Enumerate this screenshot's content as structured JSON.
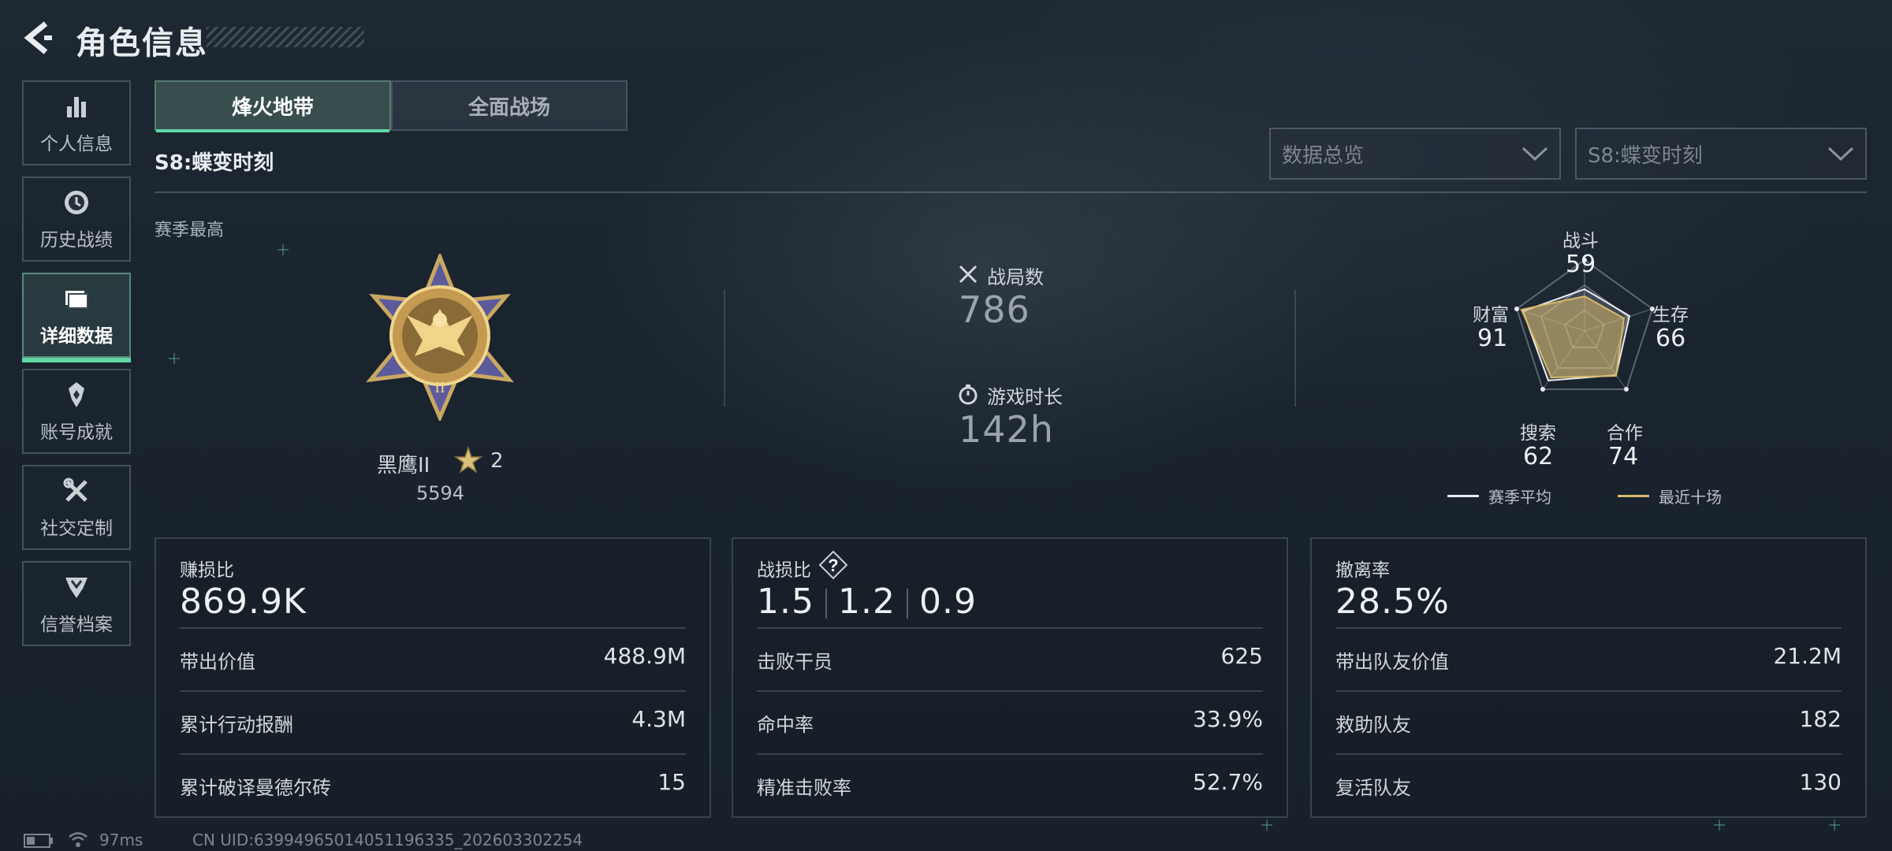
{
  "header": {
    "title": "角色信息"
  },
  "sidebar": {
    "items": [
      {
        "label": "个人信息",
        "icon": "bar-chart-icon"
      },
      {
        "label": "历史战绩",
        "icon": "history-icon"
      },
      {
        "label": "详细数据",
        "icon": "folder-icon",
        "active": true
      },
      {
        "label": "账号成就",
        "icon": "achievement-icon"
      },
      {
        "label": "社交定制",
        "icon": "tools-icon"
      },
      {
        "label": "信誉档案",
        "icon": "credit-icon"
      }
    ]
  },
  "tabs": [
    {
      "label": "烽火地带",
      "active": true
    },
    {
      "label": "全面战场",
      "active": false
    }
  ],
  "season": "S8:蝶变时刻",
  "filters": {
    "category": "数据总览",
    "season": "S8:蝶变时刻"
  },
  "season_best": {
    "label": "赛季最高",
    "rank_name": "黑鹰II",
    "stars": "2",
    "score": "5594"
  },
  "stats": {
    "matches_label": "战局数",
    "matches_value": "786",
    "playtime_label": "游戏时长",
    "playtime_value": "142h"
  },
  "radar": {
    "combat_label": "战斗",
    "combat_value": "59",
    "survival_label": "生存",
    "survival_value": "66",
    "teamwork_label": "合作",
    "teamwork_value": "74",
    "search_label": "搜索",
    "search_value": "62",
    "wealth_label": "财富",
    "wealth_value": "91",
    "legend_season": "赛季平均",
    "legend_recent": "最近十场",
    "colors": {
      "season": "#e8ecef",
      "recent": "#d8b86a"
    }
  },
  "panels": {
    "profit": {
      "title": "赚损比",
      "value": "869.9K",
      "rows": [
        {
          "label": "带出价值",
          "value": "488.9M"
        },
        {
          "label": "累计行动报酬",
          "value": "4.3M"
        },
        {
          "label": "累计破译曼德尔砖",
          "value": "15"
        }
      ]
    },
    "kd": {
      "title": "战损比",
      "values": [
        "1.5",
        "1.2",
        "0.9"
      ],
      "rows": [
        {
          "label": "击败干员",
          "value": "625"
        },
        {
          "label": "命中率",
          "value": "33.9%"
        },
        {
          "label": "精准击败率",
          "value": "52.7%"
        }
      ]
    },
    "extract": {
      "title": "撤离率",
      "value": "28.5%",
      "rows": [
        {
          "label": "带出队友价值",
          "value": "21.2M"
        },
        {
          "label": "救助队友",
          "value": "182"
        },
        {
          "label": "复活队友",
          "value": "130"
        }
      ]
    }
  },
  "footer": {
    "ping": "97ms",
    "uid": "CN UID:63994965014051196335_202603302254"
  },
  "accent": "#5fd6a4"
}
